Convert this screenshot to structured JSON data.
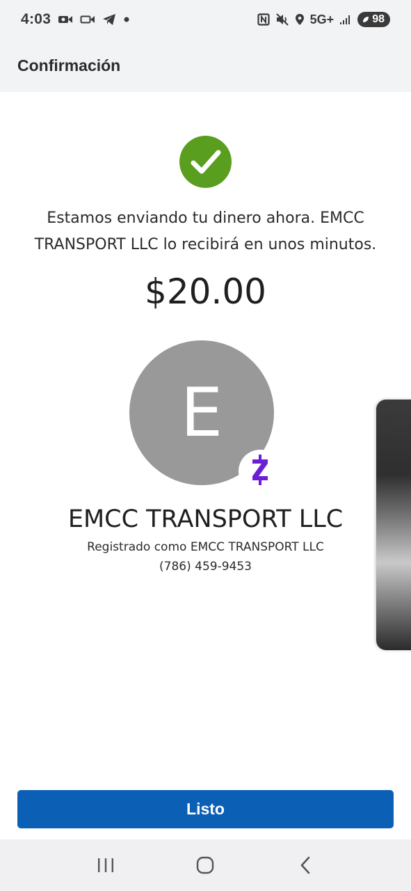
{
  "status_bar": {
    "time": "4:03",
    "network": "5G+",
    "battery": "98",
    "icons": [
      "video-camera-icon",
      "videocam-outline-icon",
      "telegram-icon",
      "dot-icon",
      "nfc-icon",
      "mute-icon",
      "location-icon",
      "signal-icon",
      "battery-icon"
    ]
  },
  "header": {
    "title": "Confirmación"
  },
  "confirmation": {
    "message": "Estamos enviando tu dinero ahora. EMCC TRANSPORT LLC lo recibirá en unos minutos.",
    "amount": "$20.00"
  },
  "recipient": {
    "initial": "E",
    "name": "EMCC TRANSPORT LLC",
    "registered_as": "Registrado como EMCC TRANSPORT LLC",
    "phone": "(786) 459-9453"
  },
  "actions": {
    "done_label": "Listo"
  },
  "colors": {
    "success_green": "#5a9e1f",
    "button_blue": "#0b5fb4",
    "zelle_purple": "#6d1ed4",
    "avatar_gray": "#999999"
  }
}
